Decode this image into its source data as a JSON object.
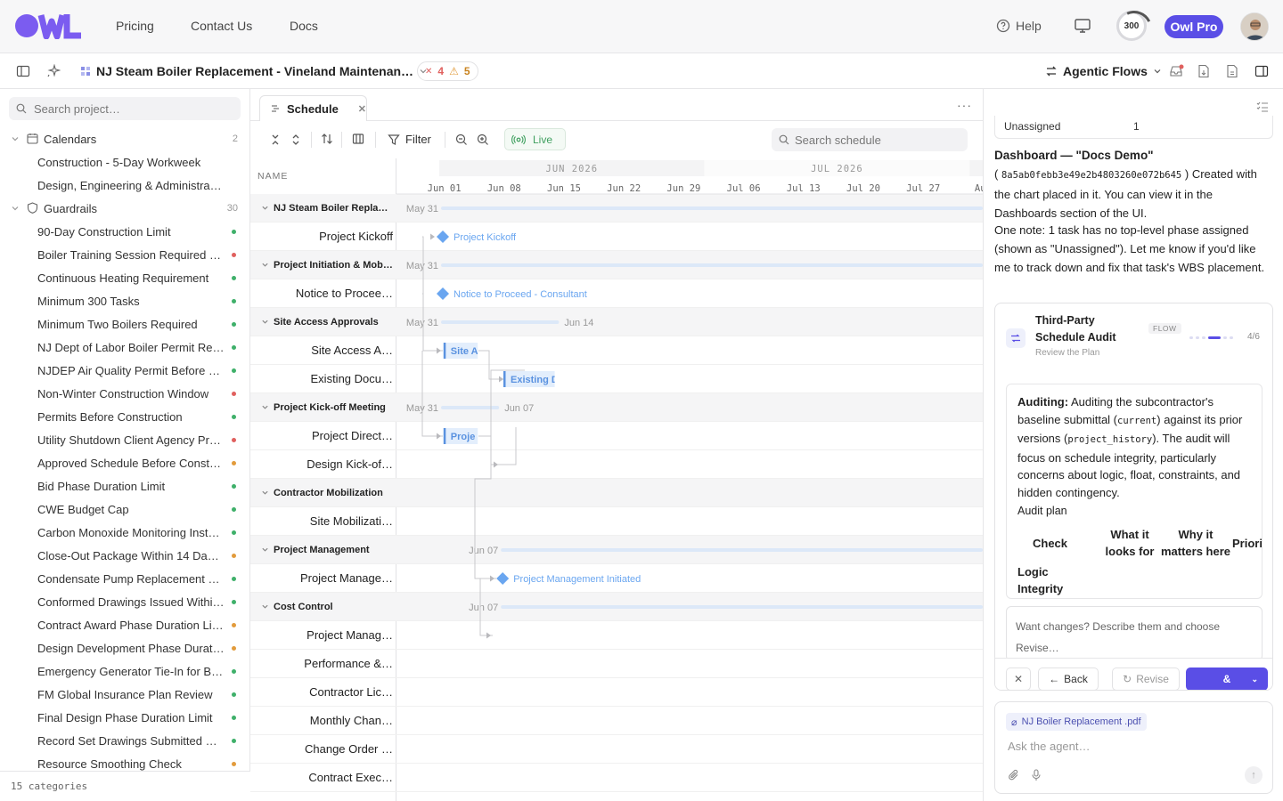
{
  "nav": {
    "links": [
      "Pricing",
      "Contact Us",
      "Docs"
    ],
    "help": "Help",
    "credits": "300",
    "pro_badge": "Owl Pro"
  },
  "toolbar2": {
    "project_title": "NJ Steam Boiler Replacement - Vineland Maintenan…",
    "errors": "4",
    "warnings": "5",
    "agentic": "Agentic Flows"
  },
  "sidebar": {
    "search_placeholder": "Search project…",
    "groups": [
      {
        "label": "Calendars",
        "count": "2"
      },
      {
        "label": "Guardrails",
        "count": "30"
      }
    ],
    "calendars": [
      "Construction - 5-Day Workweek",
      "Design, Engineering & Administrative"
    ],
    "guardrails": [
      {
        "label": "90-Day Construction Limit",
        "status": "green"
      },
      {
        "label": "Boiler Training Session Required B…",
        "status": "red"
      },
      {
        "label": "Continuous Heating Requirement",
        "status": "green"
      },
      {
        "label": "Minimum 300 Tasks",
        "status": "green"
      },
      {
        "label": "Minimum Two Boilers Required",
        "status": "green"
      },
      {
        "label": "NJ Dept of Labor Boiler Permit Re…",
        "status": "green"
      },
      {
        "label": "NJDEP Air Quality Permit Before C…",
        "status": "green"
      },
      {
        "label": "Non-Winter Construction Window",
        "status": "red"
      },
      {
        "label": "Permits Before Construction",
        "status": "green"
      },
      {
        "label": "Utility Shutdown Client Agency Pr…",
        "status": "red"
      },
      {
        "label": "Approved Schedule Before Constr…",
        "status": "orange"
      },
      {
        "label": "Bid Phase Duration Limit",
        "status": "green"
      },
      {
        "label": "CWE Budget Cap",
        "status": "green"
      },
      {
        "label": "Carbon Monoxide Monitoring Insta…",
        "status": "green"
      },
      {
        "label": "Close-Out Package Within 14 Days…",
        "status": "orange"
      },
      {
        "label": "Condensate Pump Replacement R…",
        "status": "green"
      },
      {
        "label": "Conformed Drawings Issued Withi…",
        "status": "green"
      },
      {
        "label": "Contract Award Phase Duration Li…",
        "status": "orange"
      },
      {
        "label": "Design Development Phase Durati…",
        "status": "orange"
      },
      {
        "label": "Emergency Generator Tie-In for Bo…",
        "status": "green"
      },
      {
        "label": "FM Global Insurance Plan Review",
        "status": "green"
      },
      {
        "label": "Final Design Phase Duration Limit",
        "status": "green"
      },
      {
        "label": "Record Set Drawings Submitted W…",
        "status": "green"
      },
      {
        "label": "Resource Smoothing Check",
        "status": "orange"
      }
    ],
    "footer": "15 categories"
  },
  "schedule": {
    "tab_label": "Schedule",
    "filter": "Filter",
    "live": "Live",
    "search_placeholder": "Search schedule",
    "name_header": "NAME",
    "months": [
      "JUN 2026",
      "JUL 2026"
    ],
    "weeks": [
      "Jun 01",
      "Jun 08",
      "Jun 15",
      "Jun 22",
      "Jun 29",
      "Jul 06",
      "Jul 13",
      "Jul 20",
      "Jul 27",
      "Aug"
    ],
    "rows": [
      {
        "name": "NJ Steam Boiler Replace…",
        "group": true,
        "start_label": "May 31",
        "end_label": ""
      },
      {
        "name": "Project Kickoff",
        "group": false,
        "milestone": "Project Kickoff"
      },
      {
        "name": "Project Initiation & Mobili…",
        "group": true,
        "start_label": "May 31",
        "end_label": ""
      },
      {
        "name": "Notice to Procee…",
        "group": false,
        "milestone": "Notice to Proceed - Consultant"
      },
      {
        "name": "Site Access Approvals",
        "group": true,
        "start_label": "May 31",
        "end_label": "Jun 14"
      },
      {
        "name": "Site Access A…",
        "group": false,
        "bar": "Site A"
      },
      {
        "name": "Existing Docu…",
        "group": false,
        "bar": "Existing D"
      },
      {
        "name": "Project Kick-off Meeting",
        "group": true,
        "start_label": "May 31",
        "end_label": "Jun 07"
      },
      {
        "name": "Project Direct…",
        "group": false,
        "bar": "Proje"
      },
      {
        "name": "Design Kick-of…",
        "group": false
      },
      {
        "name": "Contractor Mobilization",
        "group": true,
        "start_label": "",
        "end_label": ""
      },
      {
        "name": "Site Mobilizati…",
        "group": false
      },
      {
        "name": "Project Management",
        "group": true,
        "start_label": "Jun 07",
        "end_label": ""
      },
      {
        "name": "Project Manage…",
        "group": false,
        "milestone": "Project Management Initiated"
      },
      {
        "name": "Cost Control",
        "group": true,
        "start_label": "Jun 07",
        "end_label": ""
      },
      {
        "name": "Project Manag…",
        "group": false
      },
      {
        "name": "Performance &…",
        "group": false
      },
      {
        "name": "Contractor Lic…",
        "group": false
      },
      {
        "name": "Monthly Chan…",
        "group": false
      },
      {
        "name": "Change Order …",
        "group": false
      },
      {
        "name": "Contract Exec…",
        "group": false
      }
    ]
  },
  "agent": {
    "prev_row_label": "Unassigned",
    "prev_row_value": "1",
    "dashboard_title": "Dashboard — \"Docs Demo\"",
    "dashboard_id": "8a5ab0febb3e49e2b4803260e072b645",
    "dashboard_text": ") Created with the chart placed in it. You can view it in the Dashboards section of the UI.",
    "note": "One note: 1 task has no top-level phase assigned (shown as \"Unassigned\"). Let me know if you'd like me to track down and fix that task's WBS placement.",
    "flow": {
      "title": "Third-Party Schedule Audit",
      "subtitle": "Review the Plan",
      "badge": "FLOW",
      "progress": "4/6",
      "audit_label": "Auditing:",
      "audit_text_1": " Auditing the subcontractor's baseline submittal (",
      "audit_code_1": "current",
      "audit_text_2": ") against its prior versions (",
      "audit_code_2": "project_history",
      "audit_text_3": "). The audit will focus on schedule integrity, particularly concerns about logic, float, constraints, and hidden contingency.",
      "plan_label": "Audit plan",
      "plan_headers": [
        "Check",
        "What it looks for",
        "Why it matters here",
        "Priori"
      ],
      "plan_first_check": "Logic Integrity",
      "revise_placeholder": "Want changes? Describe them and choose Revise…",
      "back": "Back",
      "revise": "Revise",
      "approve": "&"
    },
    "attachment": "NJ Boiler Replacement .pdf",
    "ask_placeholder": "Ask the agent…"
  },
  "colors": {
    "brand": "#7b5cf0",
    "pro": "#5a4ee6",
    "milestone": "#6aa6f0",
    "today_line": "#e8a0a6",
    "green": "#3fb06a",
    "red": "#e0605e",
    "orange": "#e29b3c"
  }
}
